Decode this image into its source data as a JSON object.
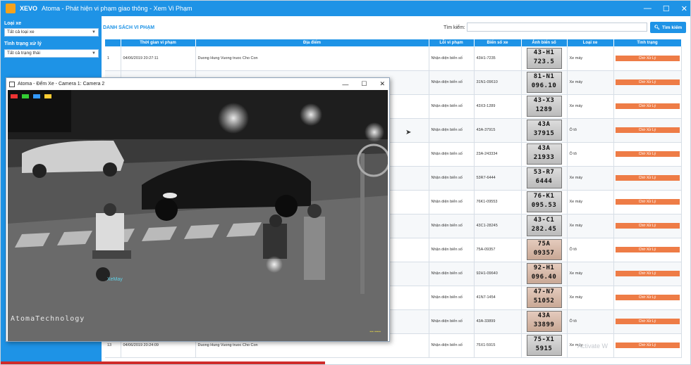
{
  "window": {
    "app_name": "XEVO",
    "title": "Atoma - Phát hiện vi phạm giao thông - Xem Vi Phạm",
    "controls": [
      "—",
      "☐",
      "✕"
    ]
  },
  "sidebar": {
    "vehicle_type_label": "Loại xe",
    "vehicle_type_value": "Tất cả loại xe",
    "status_label": "Tình trạng xử lý",
    "status_value": "Tất cả trạng thái"
  },
  "main": {
    "title": "DANH SÁCH VI PHẠM",
    "search_label": "Tìm kiếm:",
    "search_value": "",
    "search_button": "Tìm kiếm"
  },
  "table": {
    "columns": [
      "",
      "Thời gian vi phạm",
      "Địa điểm",
      "Lỗi vi phạm",
      "Biển số xe",
      "Ảnh biển số",
      "Loại xe",
      "Tình trạng"
    ],
    "rows": [
      {
        "idx": "1",
        "time": "04/06/2019 20:27:11",
        "location": "Duong Hung Vuong truoc Cho Con",
        "violation": "Nhận diện biển số",
        "plate": "43H1-7235",
        "plate_img": [
          "43-H1",
          "723.5"
        ],
        "type": "Xe máy",
        "status": "Chờ Xử Lý"
      },
      {
        "idx": "",
        "time": "",
        "location": "",
        "violation": "Nhận diện biển số",
        "plate": "31N1-09610",
        "plate_img": [
          "81-N1",
          "096.10"
        ],
        "type": "Xe máy",
        "status": "Chờ Xử Lý"
      },
      {
        "idx": "",
        "time": "",
        "location": "",
        "violation": "Nhận diện biển số",
        "plate": "43X3-1289",
        "plate_img": [
          "43-X3",
          "1289"
        ],
        "type": "Xe máy",
        "status": "Chờ Xử Lý"
      },
      {
        "idx": "",
        "time": "",
        "location": "",
        "violation": "Nhận diện biển số",
        "plate": "43A-37915",
        "plate_img": [
          "43A",
          "37915"
        ],
        "type": "Ô tô",
        "status": "Chờ Xử Lý"
      },
      {
        "idx": "",
        "time": "",
        "location": "",
        "violation": "Nhận diện biển số",
        "plate": "23A-243334",
        "plate_img": [
          "43A",
          "21933"
        ],
        "type": "Ô tô",
        "status": "Chờ Xử Lý"
      },
      {
        "idx": "",
        "time": "",
        "location": "",
        "violation": "Nhận diện biển số",
        "plate": "53R7-6444",
        "plate_img": [
          "53-R7",
          "6444"
        ],
        "type": "Xe máy",
        "status": "Chờ Xử Lý"
      },
      {
        "idx": "",
        "time": "",
        "location": "",
        "violation": "Nhận diện biển số",
        "plate": "76K1-09553",
        "plate_img": [
          "76-K1",
          "095.53"
        ],
        "type": "Xe máy",
        "status": "Chờ Xử Lý"
      },
      {
        "idx": "",
        "time": "",
        "location": "",
        "violation": "Nhận diện biển số",
        "plate": "43C1-28245",
        "plate_img": [
          "43-C1",
          "282.45"
        ],
        "type": "Xe máy",
        "status": "Chờ Xử Lý"
      },
      {
        "idx": "",
        "time": "",
        "location": "",
        "violation": "Nhận diện biển số",
        "plate": "75A-09357",
        "plate_img": [
          "75A",
          "09357"
        ],
        "type": "Ô tô",
        "status": "Chờ Xử Lý"
      },
      {
        "idx": "",
        "time": "",
        "location": "",
        "violation": "Nhận diện biển số",
        "plate": "92H1-09640",
        "plate_img": [
          "92-H1",
          "096.40"
        ],
        "type": "Xe máy",
        "status": "Chờ Xử Lý"
      },
      {
        "idx": "",
        "time": "",
        "location": "",
        "violation": "Nhận diện biển số",
        "plate": "41N7-1454",
        "plate_img": [
          "47-N7",
          "51052"
        ],
        "type": "Xe máy",
        "status": "Chờ Xử Lý"
      },
      {
        "idx": "",
        "time": "",
        "location": "",
        "violation": "Nhận diện biển số",
        "plate": "43A-33899",
        "plate_img": [
          "43A",
          "33899"
        ],
        "type": "Ô tô",
        "status": "Chờ Xử Lý"
      },
      {
        "idx": "13",
        "time": "04/06/2019 20:24:09",
        "location": "Duong Hung Vuong truoc Cho Con",
        "violation": "Nhận diện biển số",
        "plate": "75X1-5915",
        "plate_img": [
          "75-X1",
          "5915"
        ],
        "type": "Xe máy",
        "status": "Chờ Xử Lý"
      }
    ]
  },
  "camera": {
    "title": "Atoma - Đếm Xe - Camera 1: Camera 2",
    "watermark": "AtomaTechnology",
    "label_xemay": "XeMay"
  },
  "overlay": {
    "activate_text": "Activate W"
  },
  "colors": {
    "primary": "#1e93e6",
    "status": "#ee7c46"
  }
}
